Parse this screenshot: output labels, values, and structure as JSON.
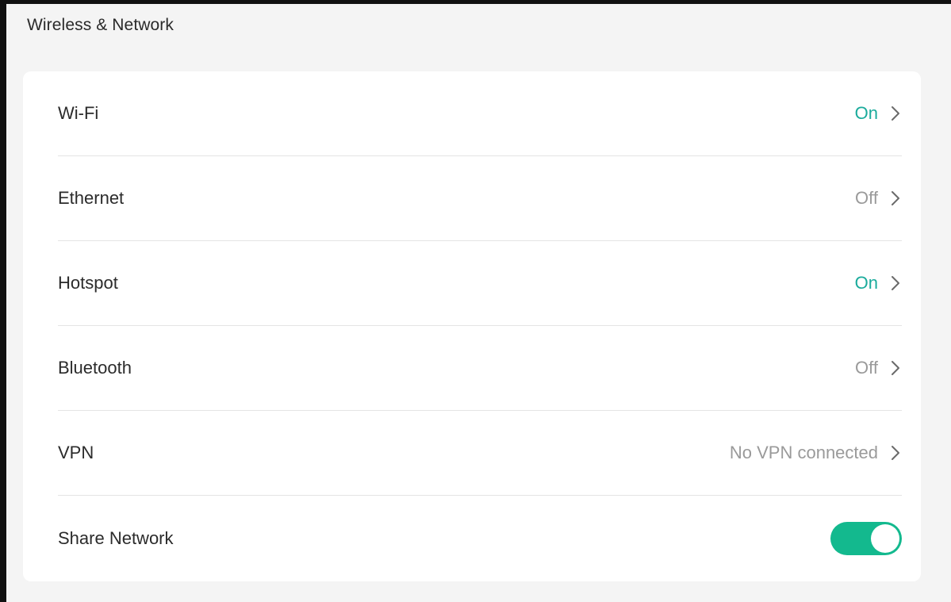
{
  "header": {
    "title": "Wireless & Network"
  },
  "colors": {
    "accent": "#13b98e",
    "value_on": "#1aab9c",
    "value_off": "#9a9a9a",
    "chevron": "#6a6a6a"
  },
  "settings": {
    "wifi": {
      "label": "Wi-Fi",
      "value": "On"
    },
    "ethernet": {
      "label": "Ethernet",
      "value": "Off"
    },
    "hotspot": {
      "label": "Hotspot",
      "value": "On"
    },
    "bluetooth": {
      "label": "Bluetooth",
      "value": "Off"
    },
    "vpn": {
      "label": "VPN",
      "value": "No VPN connected"
    },
    "share_network": {
      "label": "Share Network",
      "enabled": true
    }
  },
  "icons": {
    "chevron": "chevron-right-icon",
    "toggle": "toggle-switch"
  }
}
